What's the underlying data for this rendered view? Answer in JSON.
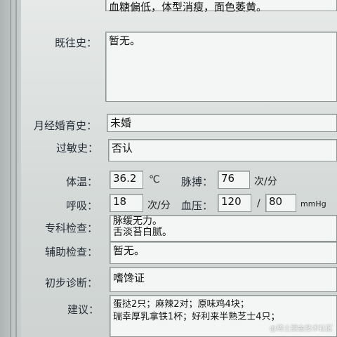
{
  "top_text": "血糖偏低，体型消瘦，面色萎黄。",
  "past_history": {
    "label": "既往史：",
    "value": "暂无。"
  },
  "menstrual": {
    "label": "月经婚育史：",
    "value": "未婚"
  },
  "allergy": {
    "label": "过敏史：",
    "value": "否认"
  },
  "vitals": {
    "temp_label": "体温：",
    "temp_value": "36.2",
    "temp_unit": "℃",
    "pulse_label": "脉搏：",
    "pulse_value": "76",
    "pulse_unit": "次/分",
    "resp_label": "呼吸：",
    "resp_value": "18",
    "resp_unit": "次/分",
    "bp_label": "血压：",
    "bp_sys": "120",
    "bp_sep": "/",
    "bp_dia": "80",
    "bp_unit": "mmHg"
  },
  "specialist": {
    "label": "专科检查：",
    "line1": "脉缓无力。",
    "line2": "舌淡苔白腻。"
  },
  "auxiliary": {
    "label": "辅助检查：",
    "value": "暂无。"
  },
  "diagnosis": {
    "label": "初步诊断：",
    "value": "嗜馋证"
  },
  "advice": {
    "label": "建议：",
    "line1": "蛋挞2只；麻辣2对；原味鸡4块；",
    "line2": "瑞幸厚乳拿铁1杯；好利来半熟芝士4只；"
  },
  "watermark": "@稀土掘金技术社区"
}
